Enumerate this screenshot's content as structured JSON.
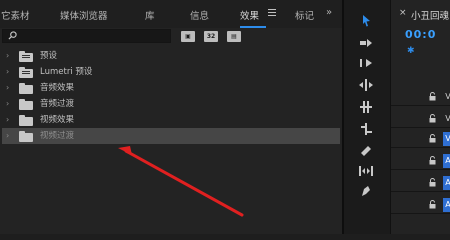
{
  "tabs": [
    "它素材",
    "媒体浏览器",
    "库",
    "信息",
    "效果",
    "标记"
  ],
  "active_tab": "效果",
  "overflow": "»",
  "search": {
    "value": "",
    "placeholder": ""
  },
  "filters": [
    "32"
  ],
  "tree": [
    {
      "label": "预设"
    },
    {
      "label": "Lumetri 预设"
    },
    {
      "label": "音频效果"
    },
    {
      "label": "音频过渡"
    },
    {
      "label": "视频效果"
    },
    {
      "label": "视频过渡",
      "selected": true
    }
  ],
  "timeline": {
    "close": "×",
    "title": "小丑回魂",
    "timecode": "00:0",
    "tracks": [
      "V",
      "V",
      "V",
      "A",
      "A",
      "A"
    ]
  },
  "colors": {
    "accent": "#2d8ceb",
    "arrow": "#e02020",
    "selected_row": "#464646"
  }
}
